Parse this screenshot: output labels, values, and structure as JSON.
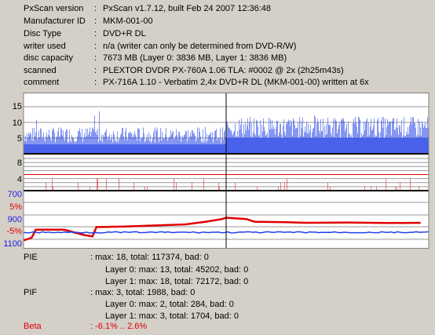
{
  "info": [
    {
      "label": "PxScan version",
      "value": "PxScan v1.7.12, built Feb 24 2007 12:36:48"
    },
    {
      "label": "Manufacturer ID",
      "value": "MKM-001-00"
    },
    {
      "label": "Disc Type",
      "value": "DVD+R DL"
    },
    {
      "label": "writer used",
      "value": "n/a (writer can only be determined from DVD-R/W)"
    },
    {
      "label": "disc capacity",
      "value": "7673 MB (Layer 0: 3836 MB,  Layer 1: 3836 MB)"
    },
    {
      "label": "scanned",
      "value": "PLEXTOR DVDR PX-760A 1.06 TLA: #0002 @ 2x (2h25m43s)"
    },
    {
      "label": "comment",
      "value": "PX-716A 1.10 - Verbatim 2,4x DVD+R DL (MKM-001-00) written at 6x"
    }
  ],
  "separator": ":",
  "axes": {
    "pie_ticks": [
      "15",
      "10",
      "5"
    ],
    "pif_ticks": [
      "8",
      "4"
    ],
    "jitter_ticks": [
      "700",
      "900",
      "1100"
    ],
    "beta_ticks": [
      "5%",
      "-5%"
    ]
  },
  "colors": {
    "pie": "#1f3fe8",
    "pif": "#e00000",
    "jitter": "#1f3fe8",
    "beta": "#e00000",
    "label_blue": "#1a1ae6",
    "label_red": "#e00000"
  },
  "stats": {
    "pie": {
      "name": "PIE",
      "total": ": max: 18, total: 117374, bad: 0",
      "layer0": "Layer 0: max: 13, total: 45202, bad: 0",
      "layer1": "Layer 1: max: 18, total: 72172, bad: 0"
    },
    "pif": {
      "name": "PIF",
      "total": ": max: 3, total: 1988, bad: 0",
      "layer0": "Layer 0: max: 2, total: 284, bad: 0",
      "layer1": "Layer 1: max: 3, total: 1704, bad: 0"
    },
    "beta": {
      "name": "Beta",
      "range": ": -6.1% .. 2.6%"
    }
  },
  "chart_data": {
    "type": "line",
    "x_range": [
      0,
      100
    ],
    "layer_break": 50,
    "pie": {
      "ylim": [
        0,
        18
      ],
      "layer0_level": 5,
      "layer1_level": 7,
      "max": 18
    },
    "pif": {
      "ylim": [
        0,
        8
      ],
      "max": 3
    },
    "beta": {
      "ylim": [
        -6.1,
        2.6
      ],
      "points": [
        [
          0,
          -6
        ],
        [
          2,
          -5
        ],
        [
          3,
          -2
        ],
        [
          10,
          -2
        ],
        [
          15,
          -4
        ],
        [
          17,
          -4.5
        ],
        [
          18,
          -1
        ],
        [
          25,
          -0.8
        ],
        [
          40,
          0
        ],
        [
          45,
          1
        ],
        [
          49,
          2
        ],
        [
          50,
          2.5
        ],
        [
          55,
          2
        ],
        [
          57,
          1
        ],
        [
          65,
          0.8
        ],
        [
          70,
          0.6
        ],
        [
          80,
          0.7
        ],
        [
          90,
          0.5
        ],
        [
          98,
          0.6
        ]
      ]
    },
    "jitter": {
      "ylim": [
        700,
        1100
      ],
      "level": 1010
    }
  }
}
